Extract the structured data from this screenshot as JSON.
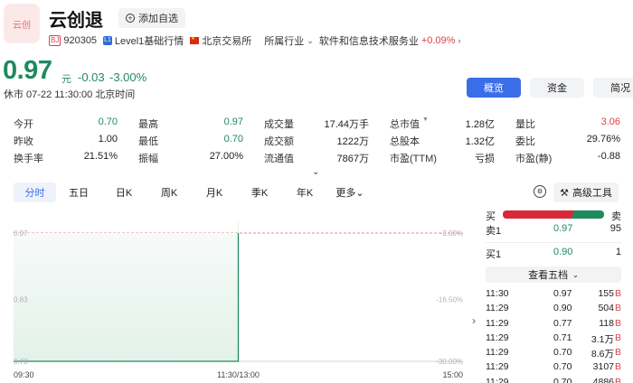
{
  "header": {
    "logo_text": "云创",
    "name": "云创退",
    "watch_label": "添加自选",
    "exchange_badge": "BJ",
    "code": "920305",
    "level_badge": "L1",
    "level_label": "Level1基础行情",
    "exchange": "北京交易所",
    "industry_label": "所属行业",
    "industry": "软件和信息技术服务业",
    "industry_pct": "+0.09%"
  },
  "quote": {
    "price": "0.97",
    "unit": "元",
    "change": "-0.03",
    "change_pct": "-3.00%",
    "status": "休市  07-22 11:30:00  北京时间"
  },
  "view_tabs": [
    {
      "label": "概览",
      "active": true
    },
    {
      "label": "资金",
      "active": false
    },
    {
      "label": "简况",
      "active": false
    }
  ],
  "stats": [
    [
      {
        "label": "今开",
        "value": "0.70",
        "color": "down"
      },
      {
        "label": "最高",
        "value": "0.97",
        "color": "down"
      },
      {
        "label": "成交量",
        "value": "17.44万手",
        "color": ""
      },
      {
        "label": "总市值",
        "value": "1.28亿",
        "color": "",
        "caret": true
      },
      {
        "label": "量比",
        "value": "3.06",
        "color": "up"
      }
    ],
    [
      {
        "label": "昨收",
        "value": "1.00",
        "color": ""
      },
      {
        "label": "最低",
        "value": "0.70",
        "color": "down"
      },
      {
        "label": "成交额",
        "value": "1222万",
        "color": ""
      },
      {
        "label": "总股本",
        "value": "1.32亿",
        "color": ""
      },
      {
        "label": "委比",
        "value": "29.76%",
        "color": ""
      }
    ],
    [
      {
        "label": "换手率",
        "value": "21.51%",
        "color": ""
      },
      {
        "label": "振幅",
        "value": "27.00%",
        "color": ""
      },
      {
        "label": "流通值",
        "value": "7867万",
        "color": ""
      },
      {
        "label": "市盈(TTM)",
        "value": "亏损",
        "color": ""
      },
      {
        "label": "市盈(静)",
        "value": "-0.88",
        "color": ""
      }
    ]
  ],
  "period_tabs": [
    {
      "label": "分时",
      "active": true
    },
    {
      "label": "五日",
      "active": false
    },
    {
      "label": "日K",
      "active": false
    },
    {
      "label": "周K",
      "active": false
    },
    {
      "label": "月K",
      "active": false
    },
    {
      "label": "季K",
      "active": false
    },
    {
      "label": "年K",
      "active": false
    },
    {
      "label": "更多",
      "active": false,
      "dropdown": true
    }
  ],
  "tools": {
    "advanced_label": "高级工具"
  },
  "chart_data": {
    "type": "line",
    "x_labels": [
      "09:30",
      "11:30/13:00",
      "15:00"
    ],
    "y_ticks": [
      {
        "price": 0.97,
        "pct": "-3.00%"
      },
      {
        "price": 0.83,
        "pct": "-16.50%"
      },
      {
        "price": 0.7,
        "pct": "-30.00%"
      }
    ],
    "y_tick_labels": [
      "0.97",
      "0.83",
      "0.70"
    ],
    "ylim": [
      0.7,
      0.97
    ],
    "reference_price": 0.97,
    "series": [
      {
        "x_fraction": [
          0,
          0.5,
          0.5
        ],
        "price": [
          0.7,
          0.7,
          0.97
        ]
      }
    ],
    "colors": {
      "line": "#1f8a5e",
      "fill": "#e9f4ef",
      "ref": "#ef8a8a"
    }
  },
  "orderbook": {
    "buy_label": "买",
    "sell_label": "卖",
    "asks": [
      {
        "label": "卖1",
        "price": "0.97",
        "volume": "95"
      }
    ],
    "bids": [
      {
        "label": "买1",
        "price": "0.90",
        "volume": "1"
      }
    ],
    "five_levels_label": "查看五档",
    "ticks": [
      {
        "time": "11:30",
        "price": "0.97",
        "vol": "155",
        "flag": "B"
      },
      {
        "time": "11:29",
        "price": "0.90",
        "vol": "504",
        "flag": "B"
      },
      {
        "time": "11:29",
        "price": "0.77",
        "vol": "118",
        "flag": "B"
      },
      {
        "time": "11:29",
        "price": "0.71",
        "vol": "3.1万",
        "flag": "B"
      },
      {
        "time": "11:29",
        "price": "0.70",
        "vol": "8.6万",
        "flag": "B"
      },
      {
        "time": "11:29",
        "price": "0.70",
        "vol": "3107",
        "flag": "B"
      },
      {
        "time": "11:29",
        "price": "0.70",
        "vol": "4886",
        "flag": "B"
      }
    ]
  }
}
